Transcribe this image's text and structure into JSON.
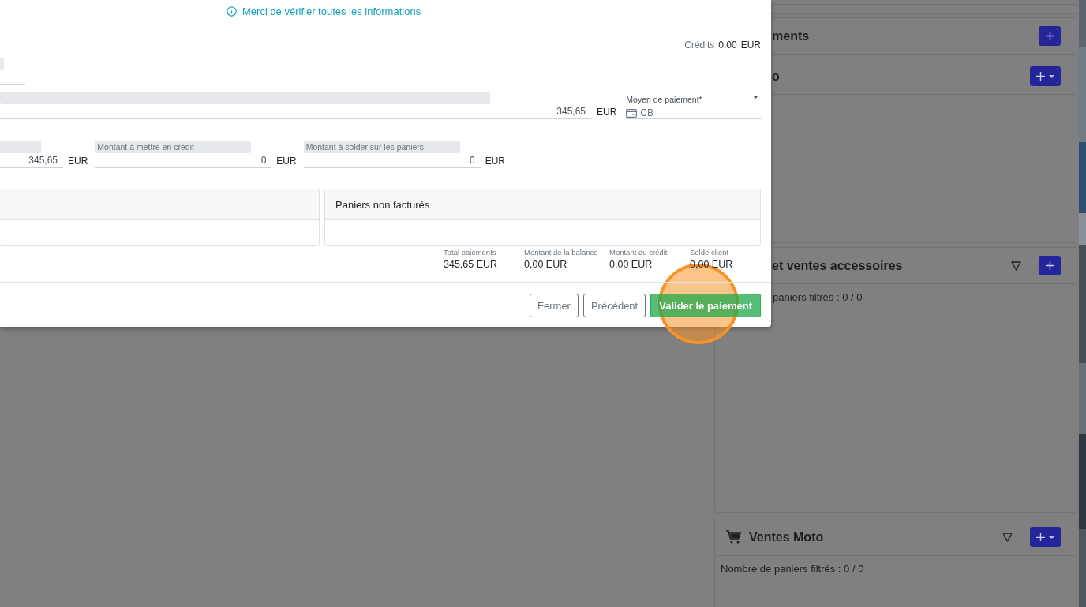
{
  "panels": [
    {
      "kind": "stub"
    },
    {
      "kind": "partial",
      "title": "ments",
      "actions": [
        {
          "kind": "add"
        }
      ]
    },
    {
      "kind": "partial",
      "title": "o",
      "actions": [
        {
          "kind": "add-menu"
        }
      ]
    },
    {
      "kind": "partial",
      "title": "et ventes accessoires",
      "actions": [
        {
          "kind": "filter"
        },
        {
          "kind": "add"
        }
      ],
      "count": "paniers filtrés : 0 / 0"
    },
    {
      "kind": "full",
      "title": "Ventes Moto",
      "actions": [
        {
          "kind": "filter"
        },
        {
          "kind": "add-menu"
        }
      ],
      "count": "Nombre de paniers filtrés : 0 / 0"
    }
  ],
  "modal": {
    "notice": "Merci de vérifier toutes les informations",
    "credits": {
      "label": "Crédits",
      "value": "0.00",
      "currency": "EUR"
    },
    "top_field": {
      "kind": "blank"
    },
    "payment_line": {
      "amount": "345,65",
      "currency": "EUR",
      "method_label": "Moyen de paiement*",
      "method_value": "CB"
    },
    "amounts": [
      {
        "value": "345,65",
        "currency": "EUR"
      },
      {
        "label": "Montant à mettre en crédit",
        "value": "0",
        "currency": "EUR"
      },
      {
        "label": "Montant à solder sur les paniers",
        "value": "0",
        "currency": "EUR"
      }
    ],
    "cards": [
      {
        "kind": "table"
      },
      {
        "kind": "table",
        "title": "Paniers non facturés"
      }
    ],
    "totals": [
      {
        "label": "Total paiements",
        "value": "345,65 EUR"
      },
      {
        "label": "Montant de la balance",
        "value": "0,00 EUR"
      },
      {
        "label": "Montant du crédit",
        "value": "0,00 EUR"
      },
      {
        "label": "Solde client",
        "value": "0,00 EUR"
      }
    ],
    "buttons": [
      {
        "label": "Fermer",
        "kind": "outline"
      },
      {
        "label": "Précédent",
        "kind": "outline"
      },
      {
        "label": "Valider le paiement",
        "kind": "primary"
      }
    ],
    "highlight": {
      "kind": "circle"
    }
  }
}
